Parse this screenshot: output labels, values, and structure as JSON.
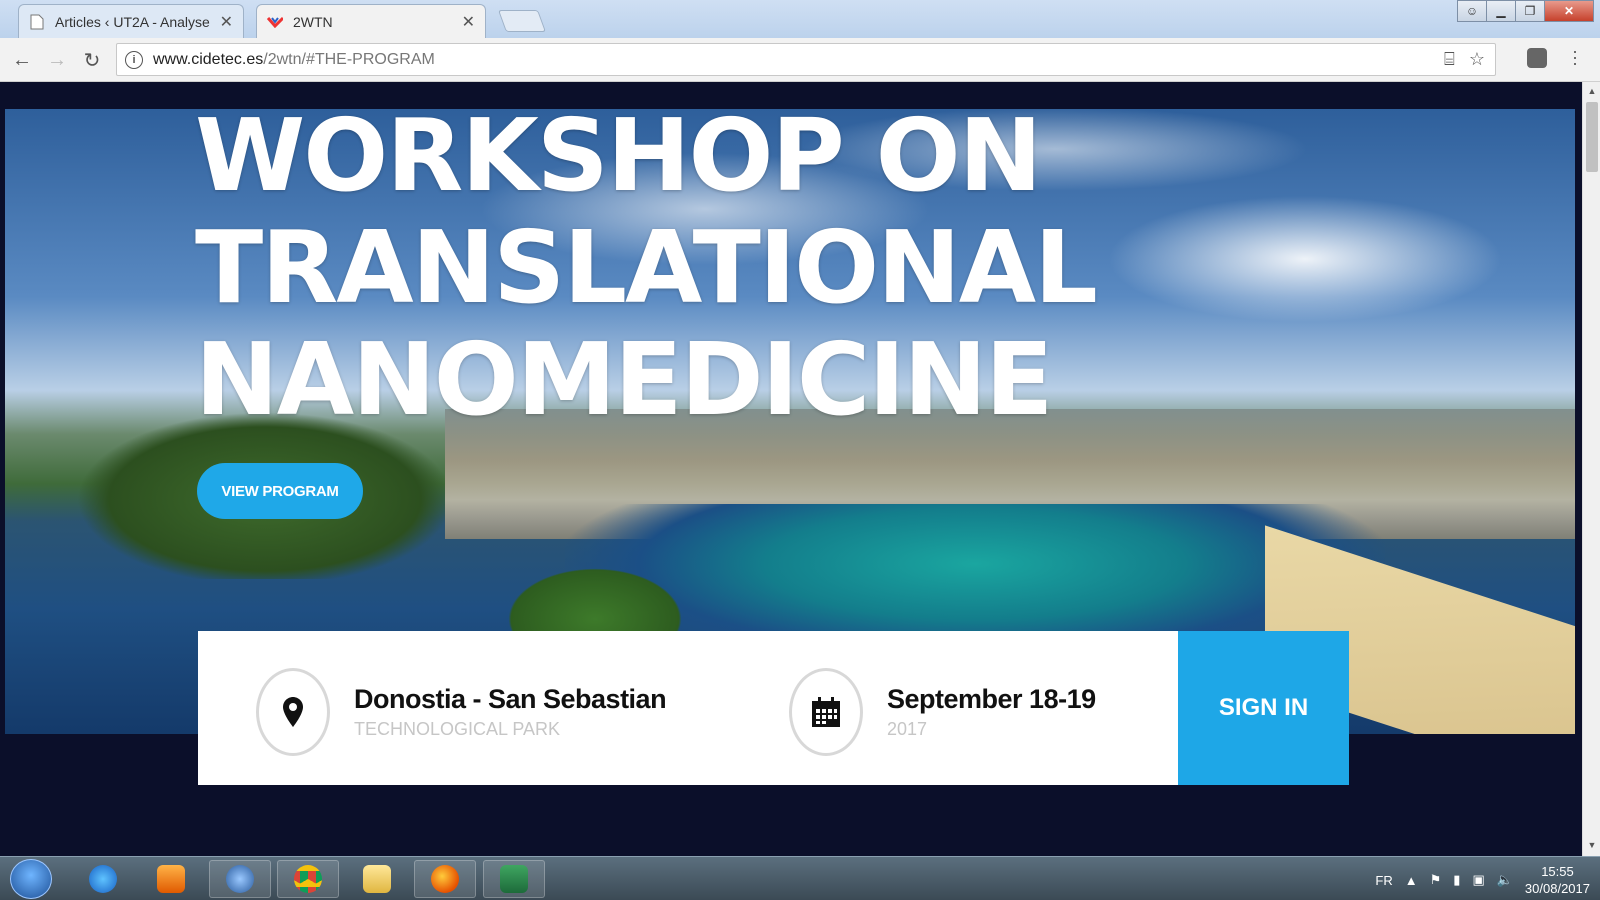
{
  "browser": {
    "tabs": [
      {
        "title": "Articles ‹ UT2A - Analyse",
        "favicon": "page-icon"
      },
      {
        "title": "2WTN",
        "favicon": "site-logo-icon",
        "active": true
      }
    ],
    "url_host": "www.cidetec.es",
    "url_path": "/2wtn/#THE-PROGRAM"
  },
  "hero": {
    "title_lines": [
      "WORKSHOP ON",
      "TRANSLATIONAL",
      "NANOMEDICINE"
    ],
    "cta_label": "VIEW PROGRAM"
  },
  "info": {
    "location_main": "Donostia - San Sebastian",
    "location_sub": "TECHNOLOGICAL PARK",
    "date_main": "September 18-19",
    "date_sub": "2017",
    "signin_label": "SIGN IN"
  },
  "taskbar": {
    "language": "FR",
    "time": "15:55",
    "date": "30/08/2017"
  },
  "colors": {
    "accent": "#1ea7e7",
    "page_bg": "#0b0f2a"
  }
}
